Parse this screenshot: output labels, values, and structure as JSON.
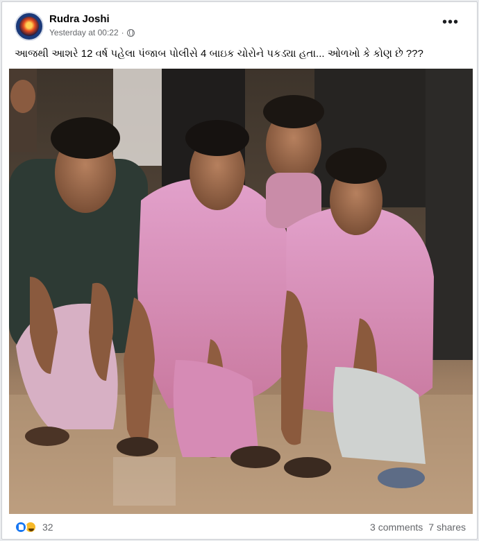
{
  "post": {
    "author": "Rudra Joshi",
    "timestamp": "Yesterday at 00:22",
    "separator": "·",
    "privacy_icon": "globe-icon",
    "more_icon": "more-options-icon",
    "more_label": "•••",
    "caption": "આજથી આશરે 12 વર્ષ પહેલા પંજાબ પોલીસે 4 બાઇક ચોરોને પકડ્યા હતા... ઓળખો કે કોણ છે ???"
  },
  "photo": {
    "subject": "four men squatting on the ground",
    "colors": {
      "shirt_pink": "#d98fbf",
      "shirt_dark": "#2d3a34",
      "ground": "#b89a7c"
    }
  },
  "engagement": {
    "reactions": [
      "like-icon",
      "haha-icon"
    ],
    "reaction_count": "32",
    "comments": "3 comments",
    "shares": "7 shares"
  },
  "colors": {
    "meta_text": "#65676b",
    "like_blue": "#1877f2",
    "haha_yellow": "#f7b928"
  }
}
